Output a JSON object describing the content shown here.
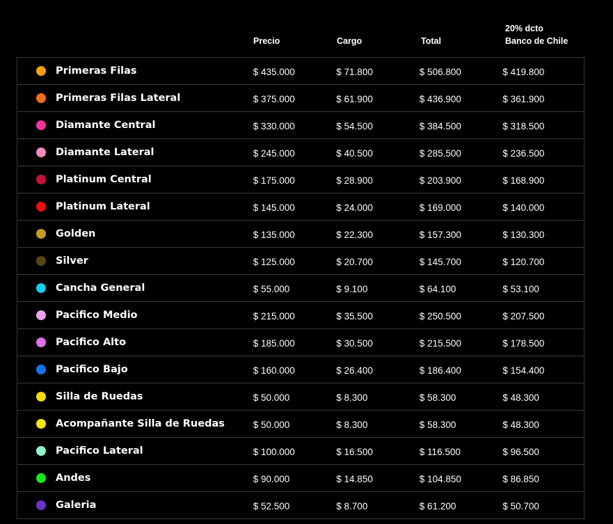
{
  "columns": {
    "price": "Precio",
    "fee": "Cargo",
    "total": "Total",
    "discount_line1": "20% dcto",
    "discount_line2": "Banco de Chile"
  },
  "rows": [
    {
      "zone": "Primeras Filas",
      "color": "#f5a00f",
      "price": "$ 435.000",
      "fee": "$ 71.800",
      "total": "$ 506.800",
      "discount": "$ 419.800"
    },
    {
      "zone": "Primeras Filas Lateral",
      "color": "#f36d14",
      "price": "$ 375.000",
      "fee": "$ 61.900",
      "total": "$ 436.900",
      "discount": "$ 361.900"
    },
    {
      "zone": "Diamante Central",
      "color": "#f0369a",
      "price": "$ 330.000",
      "fee": "$ 54.500",
      "total": "$ 384.500",
      "discount": "$ 318.500"
    },
    {
      "zone": "Diamante Lateral",
      "color": "#f489c0",
      "price": "$ 245.000",
      "fee": "$ 40.500",
      "total": "$ 285.500",
      "discount": "$ 236.500"
    },
    {
      "zone": "Platinum Central",
      "color": "#c8103e",
      "price": "$ 175.000",
      "fee": "$ 28.900",
      "total": "$ 203.900",
      "discount": "$ 168.900"
    },
    {
      "zone": "Platinum Lateral",
      "color": "#f20e0e",
      "price": "$ 145.000",
      "fee": "$ 24.000",
      "total": "$ 169.000",
      "discount": "$ 140.000"
    },
    {
      "zone": "Golden",
      "color": "#c79a23",
      "price": "$ 135.000",
      "fee": "$ 22.300",
      "total": "$ 157.300",
      "discount": "$ 130.300"
    },
    {
      "zone": "Silver",
      "color": "#5a4412",
      "price": "$ 125.000",
      "fee": "$ 20.700",
      "total": "$ 145.700",
      "discount": "$ 120.700"
    },
    {
      "zone": "Cancha General",
      "color": "#14cdf0",
      "price": "$ 55.000",
      "fee": "$ 9.100",
      "total": "$ 64.100",
      "discount": "$ 53.100"
    },
    {
      "zone": "Pacifico Medio",
      "color": "#eaa2ef",
      "price": "$ 215.000",
      "fee": "$ 35.500",
      "total": "$ 250.500",
      "discount": "$ 207.500"
    },
    {
      "zone": "Pacifico Alto",
      "color": "#e46ded",
      "price": "$ 185.000",
      "fee": "$ 30.500",
      "total": "$ 215.500",
      "discount": "$ 178.500"
    },
    {
      "zone": "Pacifico Bajo",
      "color": "#1473eb",
      "price": "$ 160.000",
      "fee": "$ 26.400",
      "total": "$ 186.400",
      "discount": "$ 154.400"
    },
    {
      "zone": "Silla de Ruedas",
      "color": "#f5dc0c",
      "price": "$ 50.000",
      "fee": "$ 8.300",
      "total": "$ 58.300",
      "discount": "$ 48.300"
    },
    {
      "zone": "Acompañante Silla de Ruedas",
      "color": "#f7e512",
      "price": "$ 50.000",
      "fee": "$ 8.300",
      "total": "$ 58.300",
      "discount": "$ 48.300"
    },
    {
      "zone": "Pacifico Lateral",
      "color": "#8ef5c6",
      "price": "$ 100.000",
      "fee": "$ 16.500",
      "total": "$ 116.500",
      "discount": "$ 96.500"
    },
    {
      "zone": "Andes",
      "color": "#18e81c",
      "price": "$ 90.000",
      "fee": "$ 14.850",
      "total": "$ 104.850",
      "discount": "$ 86.850"
    },
    {
      "zone": "Galeria",
      "color": "#6a34c9",
      "price": "$ 52.500",
      "fee": "$ 8.700",
      "total": "$ 61.200",
      "discount": "$ 50.700"
    }
  ]
}
